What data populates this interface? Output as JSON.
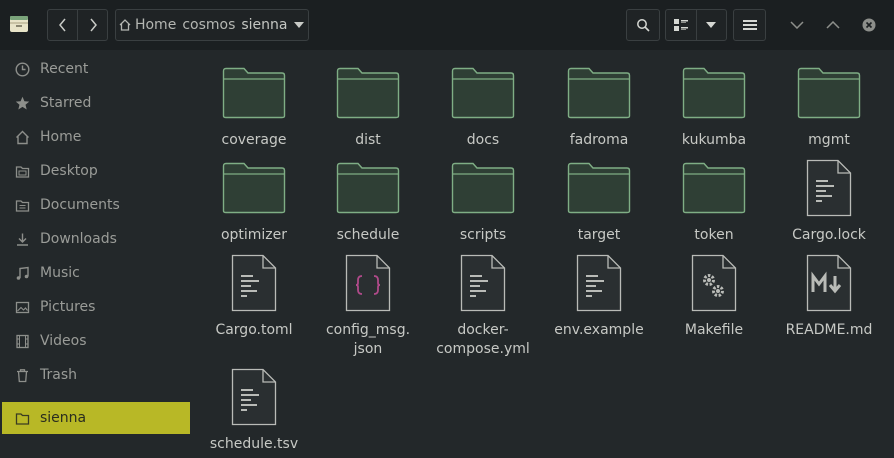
{
  "header": {
    "breadcrumbs": [
      "Home",
      "cosmos",
      "sienna"
    ]
  },
  "sidebar": {
    "items": [
      {
        "label": "Recent",
        "icon": "clock-icon"
      },
      {
        "label": "Starred",
        "icon": "star-icon"
      },
      {
        "label": "Home",
        "icon": "home-icon"
      },
      {
        "label": "Desktop",
        "icon": "folder-icon"
      },
      {
        "label": "Documents",
        "icon": "folder-icon"
      },
      {
        "label": "Downloads",
        "icon": "download-icon"
      },
      {
        "label": "Music",
        "icon": "music-icon"
      },
      {
        "label": "Pictures",
        "icon": "picture-icon"
      },
      {
        "label": "Videos",
        "icon": "video-icon"
      },
      {
        "label": "Trash",
        "icon": "trash-icon"
      },
      {
        "label": "sienna",
        "icon": "folder-icon",
        "active": true
      }
    ]
  },
  "files": [
    {
      "name": "coverage",
      "type": "folder"
    },
    {
      "name": "dist",
      "type": "folder"
    },
    {
      "name": "docs",
      "type": "folder"
    },
    {
      "name": "fadroma",
      "type": "folder"
    },
    {
      "name": "kukumba",
      "type": "folder"
    },
    {
      "name": "mgmt",
      "type": "folder"
    },
    {
      "name": "optimizer",
      "type": "folder"
    },
    {
      "name": "schedule",
      "type": "folder"
    },
    {
      "name": "scripts",
      "type": "folder"
    },
    {
      "name": "target",
      "type": "folder"
    },
    {
      "name": "token",
      "type": "folder"
    },
    {
      "name": "Cargo.lock",
      "type": "text"
    },
    {
      "name": "Cargo.toml",
      "type": "text"
    },
    {
      "name": "config_msg.\njson",
      "type": "json"
    },
    {
      "name": "docker-\ncompose.yml",
      "type": "text"
    },
    {
      "name": "env.example",
      "type": "text"
    },
    {
      "name": "Makefile",
      "type": "makefile"
    },
    {
      "name": "README.md",
      "type": "markdown"
    },
    {
      "name": "schedule.tsv",
      "type": "text"
    }
  ],
  "colors": {
    "accent": "#b8b826",
    "folder_fill": "#2f3f35",
    "folder_stroke": "#7fae85",
    "json_braces": "#b04a8a"
  }
}
